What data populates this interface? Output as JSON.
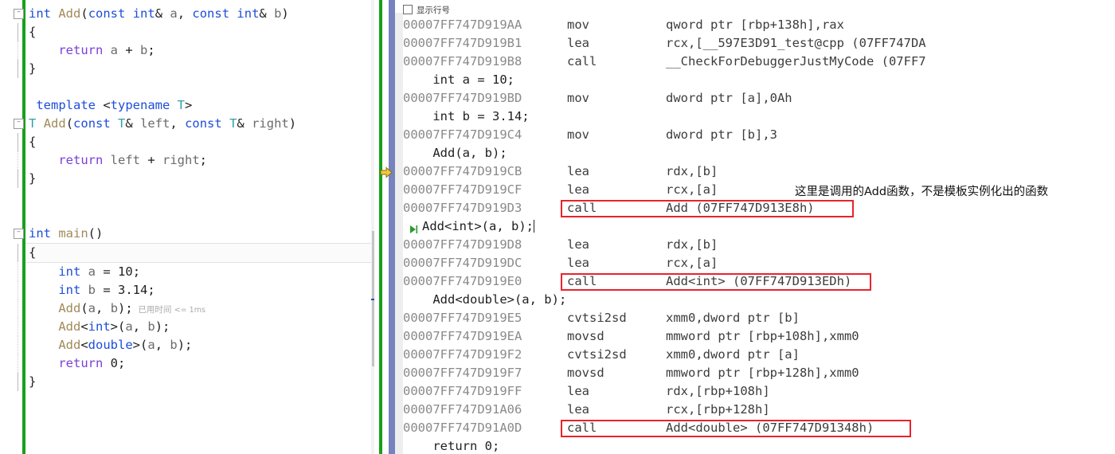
{
  "editor": {
    "lines": [
      {
        "id": "l1",
        "fold": true,
        "tokens": [
          {
            "t": "int",
            "c": "kw"
          },
          {
            "t": " ",
            "c": "punc"
          },
          {
            "t": "Add",
            "c": "fn"
          },
          {
            "t": "(",
            "c": "punc"
          },
          {
            "t": "const",
            "c": "kw"
          },
          {
            "t": " ",
            "c": "punc"
          },
          {
            "t": "int",
            "c": "kw"
          },
          {
            "t": "& ",
            "c": "punc"
          },
          {
            "t": "a",
            "c": "var"
          },
          {
            "t": ", ",
            "c": "punc"
          },
          {
            "t": "const",
            "c": "kw"
          },
          {
            "t": " ",
            "c": "punc"
          },
          {
            "t": "int",
            "c": "kw"
          },
          {
            "t": "& ",
            "c": "punc"
          },
          {
            "t": "b",
            "c": "var"
          },
          {
            "t": ")",
            "c": "punc"
          }
        ]
      },
      {
        "id": "l2",
        "bar": "solid",
        "tokens": [
          {
            "t": "{",
            "c": "punc"
          }
        ]
      },
      {
        "id": "l3",
        "bar": "dash",
        "tokens": [
          {
            "t": "    ",
            "c": "punc"
          },
          {
            "t": "return",
            "c": "kw2"
          },
          {
            "t": " ",
            "c": "punc"
          },
          {
            "t": "a",
            "c": "var"
          },
          {
            "t": " + ",
            "c": "punc"
          },
          {
            "t": "b",
            "c": "var"
          },
          {
            "t": ";",
            "c": "punc"
          }
        ]
      },
      {
        "id": "l4",
        "bar": "solid",
        "tokens": [
          {
            "t": "}",
            "c": "punc"
          }
        ]
      },
      {
        "id": "l5",
        "tokens": []
      },
      {
        "id": "l6",
        "tokens": [
          {
            "t": " ",
            "c": "punc"
          },
          {
            "t": "template",
            "c": "kw"
          },
          {
            "t": " <",
            "c": "punc"
          },
          {
            "t": "typename",
            "c": "kw"
          },
          {
            "t": " ",
            "c": "punc"
          },
          {
            "t": "T",
            "c": "ty"
          },
          {
            "t": ">",
            "c": "punc"
          }
        ]
      },
      {
        "id": "l7",
        "fold": true,
        "tokens": [
          {
            "t": "T",
            "c": "ty"
          },
          {
            "t": " ",
            "c": "punc"
          },
          {
            "t": "Add",
            "c": "fn"
          },
          {
            "t": "(",
            "c": "punc"
          },
          {
            "t": "const",
            "c": "kw"
          },
          {
            "t": " ",
            "c": "punc"
          },
          {
            "t": "T",
            "c": "ty"
          },
          {
            "t": "& ",
            "c": "punc"
          },
          {
            "t": "left",
            "c": "var"
          },
          {
            "t": ", ",
            "c": "punc"
          },
          {
            "t": "const",
            "c": "kw"
          },
          {
            "t": " ",
            "c": "punc"
          },
          {
            "t": "T",
            "c": "ty"
          },
          {
            "t": "& ",
            "c": "punc"
          },
          {
            "t": "right",
            "c": "var"
          },
          {
            "t": ")",
            "c": "punc"
          }
        ]
      },
      {
        "id": "l8",
        "bar": "solid",
        "tokens": [
          {
            "t": "{",
            "c": "punc"
          }
        ]
      },
      {
        "id": "l9",
        "bar": "dash",
        "tokens": [
          {
            "t": "    ",
            "c": "punc"
          },
          {
            "t": "return",
            "c": "kw2"
          },
          {
            "t": " ",
            "c": "punc"
          },
          {
            "t": "left",
            "c": "var"
          },
          {
            "t": " + ",
            "c": "punc"
          },
          {
            "t": "right",
            "c": "var"
          },
          {
            "t": ";",
            "c": "punc"
          }
        ]
      },
      {
        "id": "l10",
        "bar": "solid",
        "tokens": [
          {
            "t": "}",
            "c": "punc"
          }
        ]
      },
      {
        "id": "l11",
        "tokens": []
      },
      {
        "id": "l12",
        "tokens": []
      },
      {
        "id": "l13",
        "fold": true,
        "tokens": [
          {
            "t": "int",
            "c": "kw"
          },
          {
            "t": " ",
            "c": "punc"
          },
          {
            "t": "main",
            "c": "fn"
          },
          {
            "t": "()",
            "c": "punc"
          }
        ]
      },
      {
        "id": "l14",
        "current": true,
        "bar": "solid",
        "tokens": [
          {
            "t": "{",
            "c": "punc"
          }
        ]
      },
      {
        "id": "l15",
        "bar": "dash",
        "tokens": [
          {
            "t": "    ",
            "c": "punc"
          },
          {
            "t": "int",
            "c": "kw"
          },
          {
            "t": " ",
            "c": "punc"
          },
          {
            "t": "a",
            "c": "var"
          },
          {
            "t": " = ",
            "c": "punc"
          },
          {
            "t": "10",
            "c": "num"
          },
          {
            "t": ";",
            "c": "punc"
          }
        ]
      },
      {
        "id": "l16",
        "bar": "dash",
        "tokens": [
          {
            "t": "    ",
            "c": "punc"
          },
          {
            "t": "int",
            "c": "kw"
          },
          {
            "t": " ",
            "c": "punc"
          },
          {
            "t": "b",
            "c": "var"
          },
          {
            "t": " = ",
            "c": "punc"
          },
          {
            "t": "3.14",
            "c": "num"
          },
          {
            "t": ";",
            "c": "punc"
          }
        ]
      },
      {
        "id": "l17",
        "bar": "dash",
        "hint": "已用时间",
        "hint2": "<= 1ms",
        "tokens": [
          {
            "t": "    ",
            "c": "punc"
          },
          {
            "t": "Add",
            "c": "fn"
          },
          {
            "t": "(",
            "c": "punc"
          },
          {
            "t": "a",
            "c": "var"
          },
          {
            "t": ", ",
            "c": "punc"
          },
          {
            "t": "b",
            "c": "var"
          },
          {
            "t": ");",
            "c": "punc"
          }
        ]
      },
      {
        "id": "l18",
        "bar": "dash",
        "tokens": [
          {
            "t": "    ",
            "c": "punc"
          },
          {
            "t": "Add",
            "c": "fn"
          },
          {
            "t": "<",
            "c": "punc"
          },
          {
            "t": "int",
            "c": "kw"
          },
          {
            "t": ">(",
            "c": "punc"
          },
          {
            "t": "a",
            "c": "var"
          },
          {
            "t": ", ",
            "c": "punc"
          },
          {
            "t": "b",
            "c": "var"
          },
          {
            "t": ");",
            "c": "punc"
          }
        ]
      },
      {
        "id": "l19",
        "bar": "dash",
        "tokens": [
          {
            "t": "    ",
            "c": "punc"
          },
          {
            "t": "Add",
            "c": "fn"
          },
          {
            "t": "<",
            "c": "punc"
          },
          {
            "t": "double",
            "c": "kw"
          },
          {
            "t": ">(",
            "c": "punc"
          },
          {
            "t": "a",
            "c": "var"
          },
          {
            "t": ", ",
            "c": "punc"
          },
          {
            "t": "b",
            "c": "var"
          },
          {
            "t": ");",
            "c": "punc"
          }
        ]
      },
      {
        "id": "l20",
        "bar": "dash",
        "tokens": [
          {
            "t": "    ",
            "c": "punc"
          },
          {
            "t": "return",
            "c": "kw2"
          },
          {
            "t": " ",
            "c": "punc"
          },
          {
            "t": "0",
            "c": "num"
          },
          {
            "t": ";",
            "c": "punc"
          }
        ]
      },
      {
        "id": "l21",
        "bar": "solid",
        "tokens": [
          {
            "t": "}",
            "c": "punc"
          }
        ]
      }
    ],
    "code_text": [
      "int Add(const int& a, const int& b)",
      "{",
      "    return a + b;",
      "}",
      "",
      " template <typename T>",
      "T Add(const T& left, const T& right)",
      "{",
      "    return left + right;",
      "}",
      "",
      "",
      "int main()",
      "{",
      "    int a = 10;",
      "    int b = 3.14;",
      "    Add(a, b);",
      "    Add<int>(a, b);",
      "    Add<double>(a, b);",
      "    return 0;",
      "}"
    ],
    "inline_hint": {
      "label": "已用时间",
      "value": "<= 1ms"
    }
  },
  "disassembly": {
    "show_line_numbers": {
      "label": "显示行号",
      "checked": false
    },
    "rows": [
      {
        "kind": "asm",
        "addr": "00007FF747D919AA",
        "mnem": "mov",
        "ops": "qword ptr [rbp+138h],rax"
      },
      {
        "kind": "asm",
        "addr": "00007FF747D919B1",
        "mnem": "lea",
        "ops": "rcx,[__597E3D91_test@cpp (07FF747DA"
      },
      {
        "kind": "asm",
        "addr": "00007FF747D919B8",
        "mnem": "call",
        "ops": "__CheckForDebuggerJustMyCode (07FF7"
      },
      {
        "kind": "src",
        "text": "    int a = 10;"
      },
      {
        "kind": "asm",
        "addr": "00007FF747D919BD",
        "mnem": "mov",
        "ops": "dword ptr [a],0Ah"
      },
      {
        "kind": "src",
        "text": "    int b = 3.14;"
      },
      {
        "kind": "asm",
        "addr": "00007FF747D919C4",
        "mnem": "mov",
        "ops": "dword ptr [b],3"
      },
      {
        "kind": "src",
        "text": "    Add(a, b);"
      },
      {
        "kind": "asm",
        "addr": "00007FF747D919CB",
        "mnem": "lea",
        "ops": "rdx,[b]",
        "exec": true
      },
      {
        "kind": "asm",
        "addr": "00007FF747D919CF",
        "mnem": "lea",
        "ops": "rcx,[a]"
      },
      {
        "kind": "asm",
        "addr": "00007FF747D919D3",
        "mnem": "call",
        "ops": "Add (07FF747D913E8h)",
        "boxed": "box1"
      },
      {
        "kind": "src",
        "text": "Add<int>(a, b);",
        "step": true,
        "caret": true
      },
      {
        "kind": "asm",
        "addr": "00007FF747D919D8",
        "mnem": "lea",
        "ops": "rdx,[b]"
      },
      {
        "kind": "asm",
        "addr": "00007FF747D919DC",
        "mnem": "lea",
        "ops": "rcx,[a]"
      },
      {
        "kind": "asm",
        "addr": "00007FF747D919E0",
        "mnem": "call",
        "ops": "Add<int> (07FF747D913EDh)",
        "boxed": "box2"
      },
      {
        "kind": "src",
        "text": "    Add<double>(a, b);"
      },
      {
        "kind": "asm",
        "addr": "00007FF747D919E5",
        "mnem": "cvtsi2sd",
        "ops": "xmm0,dword ptr [b]"
      },
      {
        "kind": "asm",
        "addr": "00007FF747D919EA",
        "mnem": "movsd",
        "ops": "mmword ptr [rbp+108h],xmm0"
      },
      {
        "kind": "asm",
        "addr": "00007FF747D919F2",
        "mnem": "cvtsi2sd",
        "ops": "xmm0,dword ptr [a]"
      },
      {
        "kind": "asm",
        "addr": "00007FF747D919F7",
        "mnem": "movsd",
        "ops": "mmword ptr [rbp+128h],xmm0"
      },
      {
        "kind": "asm",
        "addr": "00007FF747D919FF",
        "mnem": "lea",
        "ops": "rdx,[rbp+108h]"
      },
      {
        "kind": "asm",
        "addr": "00007FF747D91A06",
        "mnem": "lea",
        "ops": "rcx,[rbp+128h]"
      },
      {
        "kind": "asm",
        "addr": "00007FF747D91A0D",
        "mnem": "call",
        "ops": "Add<double> (07FF747D91348h)",
        "boxed": "box3"
      },
      {
        "kind": "src",
        "text": "    return 0;"
      }
    ],
    "annotation": "这里是调用的Add函数，不是模板实例化出的函数"
  },
  "colors": {
    "keyword": "#1d4ed8",
    "return_keyword": "#7a3fd6",
    "function": "#a08a5a",
    "template_type": "#2f9fae",
    "variable": "#6b6b6b",
    "change_bar": "#17a01a",
    "indicator_bar": "#7683bf",
    "highlight_box": "#e8232a",
    "exec_arrow": "#e8c020",
    "step_arrow": "#2a9a2a",
    "address": "#8a8a8a"
  }
}
